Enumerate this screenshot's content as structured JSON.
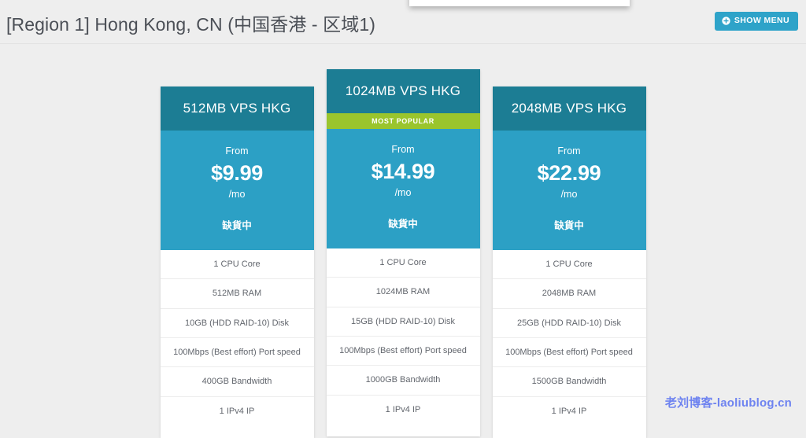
{
  "header": {
    "title": "[Region 1] Hong Kong, CN (中国香港 - 区域1)",
    "show_menu_label": "SHOW MENU",
    "show_menu_icon": "plus-circle-icon",
    "accent_color": "#2ea3c9"
  },
  "colors": {
    "page_background": "#eeeeee",
    "card_header": "#1c7d94",
    "card_price": "#2ca0c5",
    "popular_banner": "#9ac52d",
    "watermark": "#6e83f0"
  },
  "plans": [
    {
      "name": "512MB VPS HKG",
      "featured": false,
      "badge": "",
      "from_label": "From",
      "price": "$9.99",
      "period": "/mo",
      "order_status": "缺貨中",
      "features": [
        "1 CPU Core",
        "512MB RAM",
        "10GB (HDD RAID-10) Disk",
        "100Mbps (Best effort) Port speed",
        "400GB Bandwidth",
        "1 IPv4 IP"
      ]
    },
    {
      "name": "1024MB VPS HKG",
      "featured": true,
      "badge": "MOST POPULAR",
      "from_label": "From",
      "price": "$14.99",
      "period": "/mo",
      "order_status": "缺貨中",
      "features": [
        "1 CPU Core",
        "1024MB RAM",
        "15GB (HDD RAID-10) Disk",
        "100Mbps (Best effort) Port speed",
        "1000GB Bandwidth",
        "1 IPv4 IP"
      ]
    },
    {
      "name": "2048MB VPS HKG",
      "featured": false,
      "badge": "",
      "from_label": "From",
      "price": "$22.99",
      "period": "/mo",
      "order_status": "缺貨中",
      "features": [
        "1 CPU Core",
        "2048MB RAM",
        "25GB (HDD RAID-10) Disk",
        "100Mbps (Best effort) Port speed",
        "1500GB Bandwidth",
        "1 IPv4 IP"
      ]
    }
  ],
  "watermark": {
    "text": "老刘博客-laoliublog.cn"
  }
}
